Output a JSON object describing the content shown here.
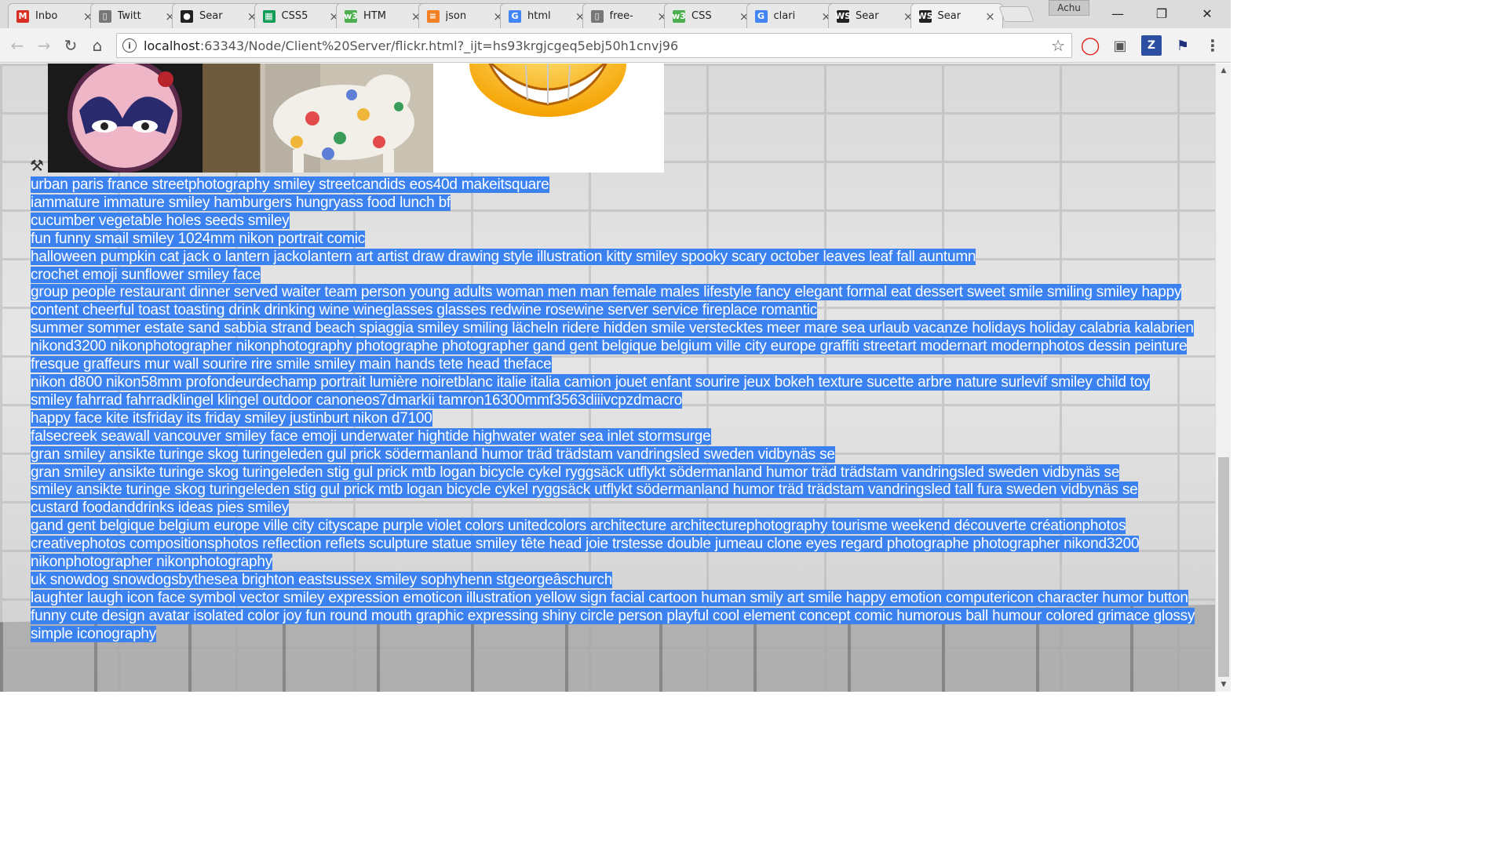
{
  "browser": {
    "tabs": [
      {
        "title": "Inbo",
        "icon": "gmail-icon",
        "color": "#d93025",
        "glyph": "M"
      },
      {
        "title": "Twitt",
        "icon": "document-icon",
        "color": "#777777",
        "glyph": "▯"
      },
      {
        "title": "Sear",
        "icon": "github-icon",
        "color": "#222222",
        "glyph": "●"
      },
      {
        "title": "CSS5",
        "icon": "sheets-icon",
        "color": "#0f9d58",
        "glyph": "▦"
      },
      {
        "title": "HTM",
        "icon": "w3schools-icon",
        "color": "#4caf50",
        "glyph": "w3"
      },
      {
        "title": "json",
        "icon": "stackoverflow-icon",
        "color": "#f48024",
        "glyph": "≡"
      },
      {
        "title": "html",
        "icon": "google-icon",
        "color": "#4285f4",
        "glyph": "G"
      },
      {
        "title": "free-",
        "icon": "document-icon",
        "color": "#777777",
        "glyph": "▯"
      },
      {
        "title": "CSS",
        "icon": "w3schools-icon",
        "color": "#4caf50",
        "glyph": "w3"
      },
      {
        "title": "clari",
        "icon": "google-icon",
        "color": "#4285f4",
        "glyph": "G"
      },
      {
        "title": "Sear",
        "icon": "webstorm-icon",
        "color": "#222222",
        "glyph": "WS"
      },
      {
        "title": "Sear",
        "icon": "webstorm-icon",
        "color": "#222222",
        "glyph": "WS",
        "active": true
      }
    ],
    "profile_name": "Achu",
    "url_host": "localhost",
    "url_rest": ":63343/Node/Client%20Server/flickr.html?_ijt=hs93krgjcgeq5ebj50h1cnvj96"
  },
  "page": {
    "captions": [
      "urban paris france streetphotography smiley streetcandids eos40d makeitsquare",
      "iammature immature smiley hamburgers hungryass food lunch bf",
      "cucumber vegetable holes seeds smiley",
      "fun funny smail smiley 1024mm nikon portrait comic",
      "halloween pumpkin cat jack o lantern jackolantern art artist draw drawing style illustration kitty smiley spooky scary october leaves leaf fall auntumn",
      "crochet emoji sunflower smiley face",
      "group people restaurant dinner served waiter team person young adults woman men man female males lifestyle fancy elegant formal eat dessert sweet smile smiling smiley happy content cheerful toast toasting drink drinking wine wineglasses glasses redwine rosewine server service fireplace romantic",
      "summer sommer estate sand sabbia strand beach spiaggia smiley smiling lächeln ridere hidden smile verstecktes meer mare sea urlaub vacanze holidays holiday calabria kalabrien",
      "nikond3200 nikonphotographer nikonphotography photographe photographer gand gent belgique belgium ville city europe graffiti streetart modernart modernphotos dessin peinture fresque graffeurs mur wall sourire rire smile smiley main hands tete head theface",
      "nikon d800 nikon58mm profondeurdechamp portrait lumière noiretblanc italie italia camion jouet enfant sourire jeux bokeh texture sucette arbre nature surlevif smiley child toy",
      "smiley fahrrad fahrradklingel klingel outdoor canoneos7dmarkii tamron16300mmf3563diiivcpzdmacro",
      "happy face kite itsfriday its friday smiley justinburt nikon d7100",
      "falsecreek seawall vancouver smiley face emoji underwater hightide highwater water sea inlet stormsurge",
      "gran smiley ansikte turinge skog turingeleden gul prick södermanland humor träd trädstam vandringsled sweden vidbynäs se",
      "gran smiley ansikte turinge skog turingeleden stig gul prick mtb logan bicycle cykel ryggsäck utflykt södermanland humor träd trädstam vandringsled sweden vidbynäs se",
      "smiley ansikte turinge skog turingeleden stig gul prick mtb logan bicycle cykel ryggsäck utflykt södermanland humor träd trädstam vandringsled tall fura sweden vidbynäs se",
      "custard foodanddrinks ideas pies smiley",
      "gand gent belgique belgium europe ville city cityscape purple violet colors unitedcolors architecture architecturephotography tourisme weekend découverte créationphotos creativephotos compositionsphotos reflection reflets sculpture statue smiley tête head joie trstesse double jumeau clone eyes regard photographe photographer nikond3200 nikonphotographer nikonphotography",
      "uk snowdog snowdogsbythesea brighton eastsussex smiley sophyhenn stgeorgeâschurch",
      "laughter laugh icon face symbol vector smiley expression emoticon illustration yellow sign facial cartoon human smily art smile happy emotion computericon character humor button funny cute design avatar isolated color joy fun round mouth graphic expressing shiny circle person playful cool element concept comic humorous ball humour colored grimace glossy simple iconography"
    ],
    "selection_color": "#3b82f0"
  }
}
